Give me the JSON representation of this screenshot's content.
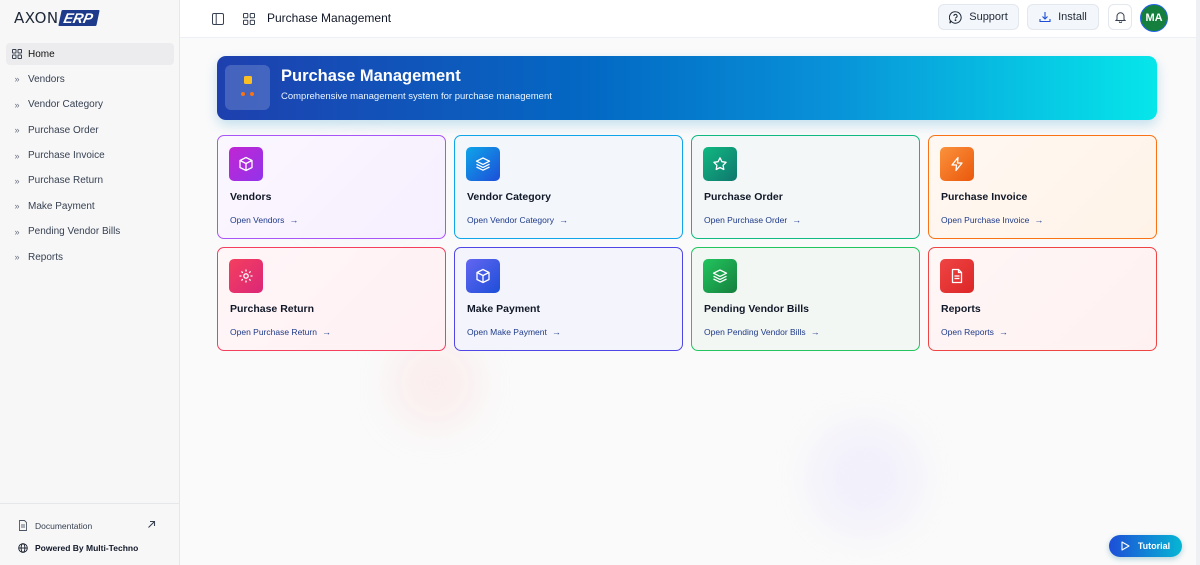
{
  "brand": {
    "name_plain": "AXON",
    "name_badge": "ERP"
  },
  "sidebar": {
    "items": [
      {
        "label": "Home",
        "icon": "grid-icon",
        "active": true
      },
      {
        "label": "Vendors",
        "icon": "chevrons-right-icon"
      },
      {
        "label": "Vendor Category",
        "icon": "chevrons-right-icon"
      },
      {
        "label": "Purchase Order",
        "icon": "chevrons-right-icon"
      },
      {
        "label": "Purchase Invoice",
        "icon": "chevrons-right-icon"
      },
      {
        "label": "Purchase Return",
        "icon": "chevrons-right-icon"
      },
      {
        "label": "Make Payment",
        "icon": "chevrons-right-icon"
      },
      {
        "label": "Pending Vendor Bills",
        "icon": "chevrons-right-icon"
      },
      {
        "label": "Reports",
        "icon": "chevrons-right-icon"
      }
    ],
    "footer": {
      "documentation": "Documentation",
      "powered_by": "Powered By Multi-Techno"
    }
  },
  "header": {
    "title": "Purchase Management",
    "support_label": "Support",
    "install_label": "Install",
    "avatar_initials": "MA"
  },
  "hero": {
    "title": "Purchase Management",
    "subtitle": "Comprehensive management system for purchase management"
  },
  "cards": [
    {
      "title": "Vendors",
      "link": "Open Vendors",
      "icon": "box-icon",
      "color": "#9333ea"
    },
    {
      "title": "Vendor Category",
      "link": "Open Vendor Category",
      "icon": "layers-icon",
      "color": "#0284c7"
    },
    {
      "title": "Purchase Order",
      "link": "Open Purchase Order",
      "icon": "star-icon",
      "color": "#059669"
    },
    {
      "title": "Purchase Invoice",
      "link": "Open Purchase Invoice",
      "icon": "zap-icon",
      "color": "#ea580c"
    },
    {
      "title": "Purchase Return",
      "link": "Open Purchase Return",
      "icon": "gear-icon",
      "color": "#e11d48"
    },
    {
      "title": "Make Payment",
      "link": "Open Make Payment",
      "icon": "box-icon",
      "color": "#4f46e5"
    },
    {
      "title": "Pending Vendor Bills",
      "link": "Open Pending Vendor Bills",
      "icon": "layers-icon",
      "color": "#16a34a"
    },
    {
      "title": "Reports",
      "link": "Open Reports",
      "icon": "file-icon",
      "color": "#dc2626"
    }
  ],
  "tutorial_label": "Tutorial"
}
